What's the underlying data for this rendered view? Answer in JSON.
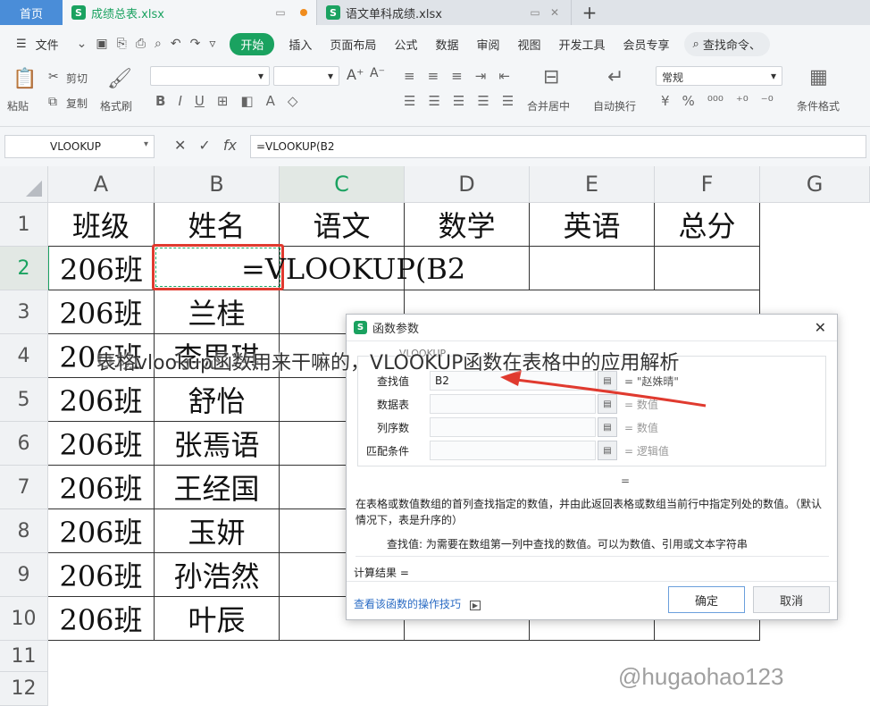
{
  "tabs": {
    "home": "首页",
    "file1": "成绩总表.xlsx",
    "file2": "语文单科成绩.xlsx",
    "logo": "S"
  },
  "menu": {
    "file": "文件",
    "start": "开始",
    "items": [
      "插入",
      "页面布局",
      "公式",
      "数据",
      "审阅",
      "视图",
      "开发工具",
      "会员专享"
    ],
    "search": "查找命令、"
  },
  "ribbon": {
    "paste": "粘贴",
    "cut": "剪切",
    "copy": "复制",
    "format_painter": "格式刷",
    "bold": "B",
    "italic": "I",
    "underline": "U",
    "font_grow": "A⁺",
    "font_shrink": "A⁻",
    "merge": "合并居中",
    "wrap": "自动换行",
    "number_format": "常规",
    "currency": "¥",
    "percent": "%",
    "cond_format": "条件格式"
  },
  "formula_bar": {
    "name_box": "VLOOKUP",
    "cancel": "✕",
    "confirm": "✓",
    "fx": "fx",
    "content": "=VLOOKUP(B2"
  },
  "sheet": {
    "columns": [
      "A",
      "B",
      "C",
      "D",
      "E",
      "F",
      "G"
    ],
    "rows": [
      "1",
      "2",
      "3",
      "4",
      "5",
      "6",
      "7",
      "8",
      "9",
      "10",
      "11",
      "12"
    ],
    "headers": [
      "班级",
      "姓名",
      "语文",
      "数学",
      "英语",
      "总分"
    ],
    "class_values": [
      "206班",
      "206班",
      "206班",
      "206班",
      "206班",
      "206班",
      "206班",
      "206班",
      "206班"
    ],
    "names": [
      "兰桂",
      "李思琪",
      "舒怡",
      "张焉语",
      "王经国",
      "玉妍",
      "孙浩然",
      "叶辰"
    ],
    "editing_formula": "=VLOOKUP(B2"
  },
  "dialog": {
    "logo": "S",
    "title": "函数参数",
    "close": "✕",
    "group_label": "VLOOKUP",
    "params": [
      {
        "label": "查找值",
        "value": "B2",
        "result": "= \"赵姝晴\""
      },
      {
        "label": "数据表",
        "value": "",
        "result": "= 数值"
      },
      {
        "label": "列序数",
        "value": "",
        "result": "= 数值"
      },
      {
        "label": "匹配条件",
        "value": "",
        "result": "= 逻辑值"
      }
    ],
    "equals": "=",
    "description": "在表格或数值数组的首列查找指定的数值，并由此返回表格或数组当前行中指定列处的数值。（默认情况下，表是升序的）",
    "detail": "查找值:  为需要在数组第一列中查找的数值。可以为数值、引用或文本字符串",
    "result_label": "计算结果 =",
    "help_link": "查看该函数的操作技巧",
    "ok": "确定",
    "cancel": "取消"
  },
  "overlay_caption": "表格vlookup函数用来干嘛的，VLOOKUP函数在表格中的应用解析",
  "watermark": "@hugaohao123",
  "colors": {
    "accent": "#1aa260",
    "home_tab": "#4a8dd8",
    "highlight": "#e03a2f"
  }
}
